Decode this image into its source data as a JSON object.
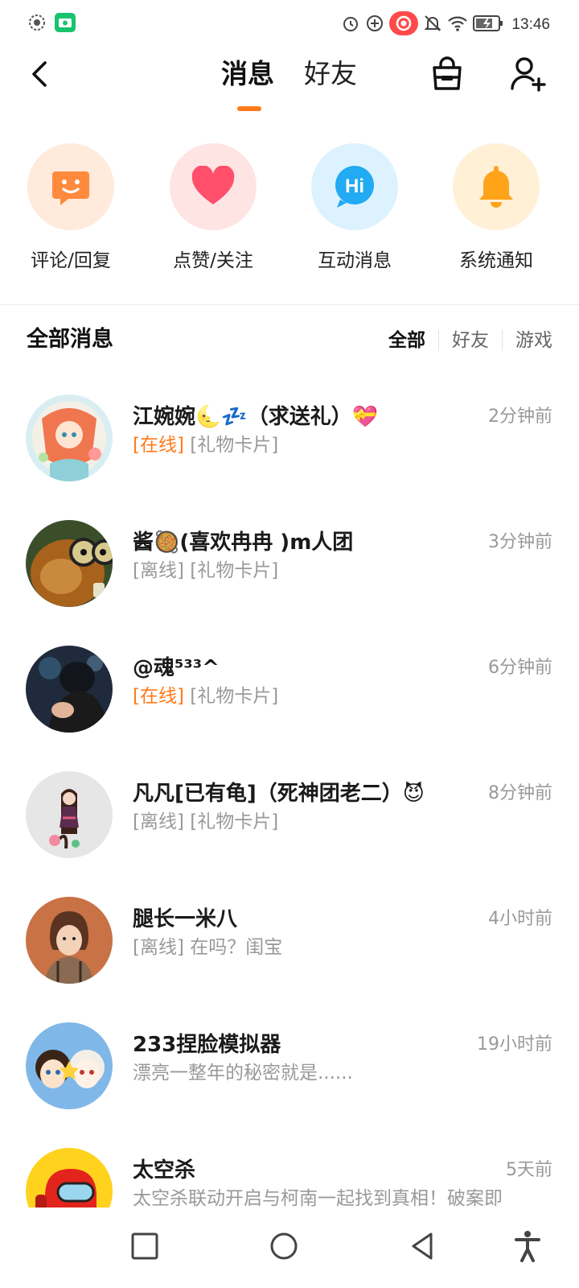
{
  "status_bar": {
    "time": "13:46"
  },
  "header": {
    "tabs": [
      {
        "label": "消息",
        "active": true
      },
      {
        "label": "好友",
        "active": false
      }
    ]
  },
  "categories": [
    {
      "label": "评论/回复",
      "icon": "comment-face-icon",
      "bg": "#ffeadc",
      "color": "#ff8a3d"
    },
    {
      "label": "点赞/关注",
      "icon": "heart-icon",
      "bg": "#ffe4e4",
      "color": "#ff4f6a"
    },
    {
      "label": "互动消息",
      "icon": "hi-bubble-icon",
      "bg": "#dcf2ff",
      "color": "#22aaf2"
    },
    {
      "label": "系统通知",
      "icon": "bell-icon",
      "bg": "#fff0d6",
      "color": "#ffa319"
    }
  ],
  "section": {
    "title": "全部消息",
    "filters": [
      {
        "label": "全部",
        "active": true
      },
      {
        "label": "好友",
        "active": false
      },
      {
        "label": "游戏",
        "active": false
      }
    ]
  },
  "messages": [
    {
      "name": "江婉婉🌜💤（求送礼）💝",
      "status": "[在线]",
      "status_online": true,
      "preview": " [礼物卡片]",
      "time": "2分钟前"
    },
    {
      "name": "酱🥘(喜欢冉冉 )m人团",
      "status": "[离线]",
      "status_online": false,
      "preview": " [礼物卡片]",
      "time": "3分钟前"
    },
    {
      "name": "@魂⁵³³^",
      "status": "[在线]",
      "status_online": true,
      "preview": " [礼物卡片]",
      "time": "6分钟前"
    },
    {
      "name": "凡凡[已有龟]（死神团老二）😈",
      "status": "[离线]",
      "status_online": false,
      "preview": " [礼物卡片]",
      "time": "8分钟前"
    },
    {
      "name": "腿长一米八",
      "status": "[离线]",
      "status_online": false,
      "preview": " 在吗？闺宝",
      "time": "4小时前"
    },
    {
      "name": "233捏脸模拟器",
      "status": "",
      "status_online": false,
      "preview": "漂亮一整年的秘密就是......",
      "time": "19小时前"
    },
    {
      "name": "太空杀",
      "status": "",
      "status_online": false,
      "preview": "太空杀联动开启与柯南一起找到真相！破案即",
      "time": "5天前"
    }
  ]
}
